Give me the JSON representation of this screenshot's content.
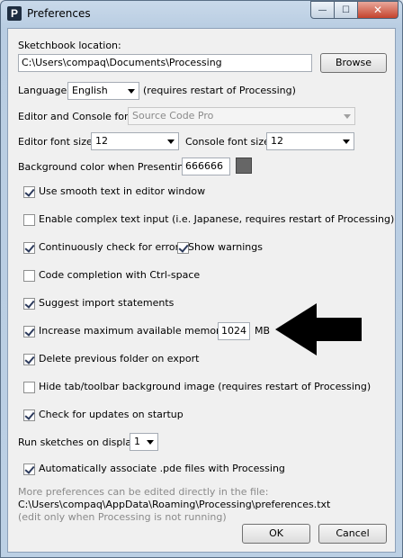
{
  "window": {
    "title": "Preferences",
    "app_icon": "P"
  },
  "controls": {
    "minimize": "—",
    "maximize": "☐",
    "close": "✕"
  },
  "sketchbook": {
    "label": "Sketchbook location:",
    "path": "C:\\Users\\compaq\\Documents\\Processing",
    "browse": "Browse"
  },
  "language": {
    "label": "Language:",
    "value": "English",
    "note": "(requires restart of Processing)"
  },
  "font": {
    "label": "Editor and Console font:",
    "value": "Source Code Pro"
  },
  "sizes": {
    "editor_label": "Editor font size:",
    "editor_value": "12",
    "console_label": "Console font size:",
    "console_value": "12"
  },
  "bg": {
    "label": "Background color when Presenting: #",
    "value": "666666",
    "swatch_color": "#666666"
  },
  "options": {
    "smooth": "Use smooth text in editor window",
    "complex": "Enable complex text input (i.e. Japanese, requires restart of Processing)",
    "errors": "Continuously check for errors",
    "warnings": "Show warnings",
    "completion": "Code completion with Ctrl-space",
    "imports": "Suggest import statements",
    "memory": "Increase maximum available memory to:",
    "memory_value": "1024",
    "memory_unit": "MB",
    "delete": "Delete previous folder on export",
    "hide_bg": "Hide tab/toolbar background image (requires restart of Processing)",
    "updates": "Check for updates on startup"
  },
  "display": {
    "label": "Run sketches on display:",
    "value": "1"
  },
  "associate": "Automatically associate .pde files with Processing",
  "footer": {
    "line1": "More preferences can be edited directly in the file:",
    "line2": "C:\\Users\\compaq\\AppData\\Roaming\\Processing\\preferences.txt",
    "line3": "(edit only when Processing is not running)"
  },
  "buttons": {
    "ok": "OK",
    "cancel": "Cancel"
  }
}
